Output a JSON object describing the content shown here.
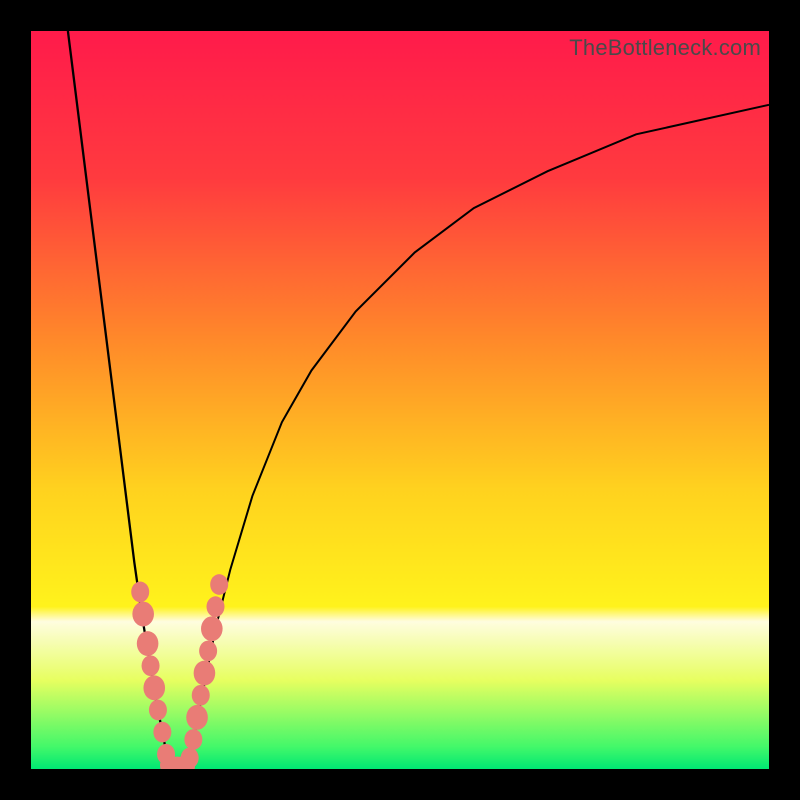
{
  "watermark": "TheBottleneck.com",
  "colors": {
    "frame": "#000000",
    "gradient_stops": [
      {
        "pos": 0.0,
        "color": "#ff1b4b"
      },
      {
        "pos": 0.2,
        "color": "#ff3b3f"
      },
      {
        "pos": 0.42,
        "color": "#ff8a2a"
      },
      {
        "pos": 0.62,
        "color": "#ffd21f"
      },
      {
        "pos": 0.78,
        "color": "#fff31c"
      },
      {
        "pos": 0.8,
        "color": "#fffde0"
      },
      {
        "pos": 0.88,
        "color": "#e7ff60"
      },
      {
        "pos": 0.97,
        "color": "#43f86a"
      },
      {
        "pos": 1.0,
        "color": "#00e874"
      }
    ],
    "curve": "#000000",
    "marker": "#e97c76"
  },
  "chart_data": {
    "type": "line",
    "title": "",
    "xlabel": "",
    "ylabel": "",
    "xlim": [
      0,
      100
    ],
    "ylim": [
      0,
      100
    ],
    "grid": false,
    "legend": false,
    "series": [
      {
        "name": "left-branch",
        "x": [
          5.0,
          6.0,
          7.0,
          8.0,
          9.0,
          10.0,
          11.0,
          12.0,
          13.0,
          14.0,
          15.0,
          16.0,
          17.0,
          18.0,
          18.7
        ],
        "y": [
          100,
          92,
          84,
          76,
          68,
          60,
          52,
          44,
          36,
          28,
          21,
          15,
          9,
          4,
          0
        ]
      },
      {
        "name": "right-branch",
        "x": [
          21.3,
          22.0,
          23.0,
          24.0,
          25.0,
          27.0,
          30.0,
          34.0,
          38.0,
          44.0,
          52.0,
          60.0,
          70.0,
          82.0,
          100.0
        ],
        "y": [
          0,
          4,
          9,
          14,
          19,
          27,
          37,
          47,
          54,
          62,
          70,
          76,
          81,
          86,
          90
        ]
      }
    ],
    "markers": {
      "name": "data-points",
      "points": [
        {
          "x": 14.8,
          "y": 24,
          "r": 1.0
        },
        {
          "x": 15.2,
          "y": 21,
          "r": 1.2
        },
        {
          "x": 15.8,
          "y": 17,
          "r": 1.2
        },
        {
          "x": 16.2,
          "y": 14,
          "r": 1.0
        },
        {
          "x": 16.7,
          "y": 11,
          "r": 1.2
        },
        {
          "x": 17.2,
          "y": 8,
          "r": 1.0
        },
        {
          "x": 17.8,
          "y": 5,
          "r": 1.0
        },
        {
          "x": 18.3,
          "y": 2,
          "r": 1.0
        },
        {
          "x": 18.7,
          "y": 0.5,
          "r": 1.0
        },
        {
          "x": 19.2,
          "y": 0.3,
          "r": 1.0
        },
        {
          "x": 19.8,
          "y": 0.3,
          "r": 1.0
        },
        {
          "x": 20.4,
          "y": 0.3,
          "r": 1.0
        },
        {
          "x": 21.0,
          "y": 0.4,
          "r": 1.0
        },
        {
          "x": 21.5,
          "y": 1.5,
          "r": 1.0
        },
        {
          "x": 22.0,
          "y": 4,
          "r": 1.0
        },
        {
          "x": 22.5,
          "y": 7,
          "r": 1.2
        },
        {
          "x": 23.0,
          "y": 10,
          "r": 1.0
        },
        {
          "x": 23.5,
          "y": 13,
          "r": 1.2
        },
        {
          "x": 24.0,
          "y": 16,
          "r": 1.0
        },
        {
          "x": 24.5,
          "y": 19,
          "r": 1.2
        },
        {
          "x": 25.0,
          "y": 22,
          "r": 1.0
        },
        {
          "x": 25.5,
          "y": 25,
          "r": 1.0
        }
      ]
    }
  }
}
